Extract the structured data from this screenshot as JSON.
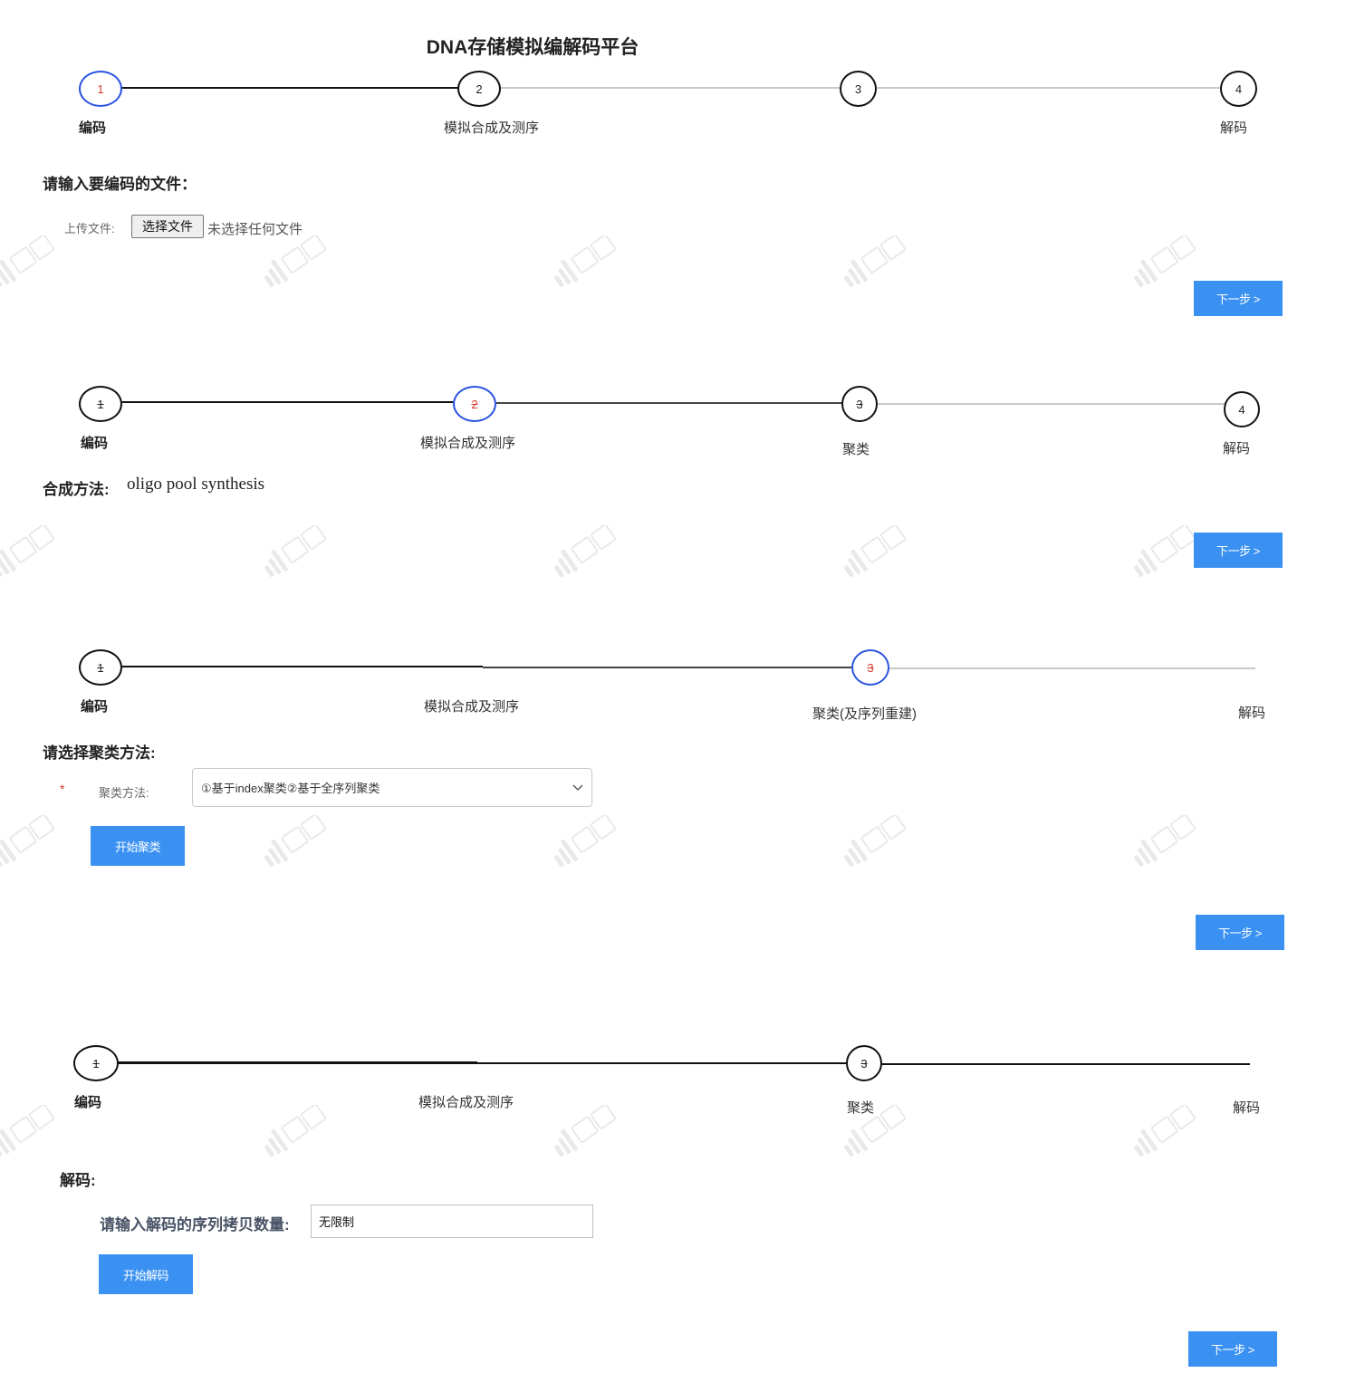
{
  "page_title": "DNA存储模拟编解码平台",
  "steps_1": [
    "编码",
    "模拟合成及测序",
    "解码"
  ],
  "steps_2": [
    "编码",
    "模拟合成及测序",
    "聚类",
    "解码"
  ],
  "steps_3": [
    "编码",
    "模拟合成及测序",
    "聚类(及序列重建)",
    "解码"
  ],
  "steps_4": [
    "编码",
    "模拟合成及测序",
    "聚类",
    "解码"
  ],
  "step_numbers": [
    "1",
    "2",
    "3",
    "4"
  ],
  "encode": {
    "heading": "请输入要编码的文件：",
    "upload_label": "上传文件:",
    "file_button": "选择文件",
    "file_status": "未选择任何文件"
  },
  "synthesis": {
    "heading": "合成方法:",
    "value": "oligo pool synthesis"
  },
  "cluster": {
    "heading": "请选择聚类方法:",
    "required_mark": "*",
    "method_label": "聚类方法:",
    "method_value": "①基于index聚类②基于全序列聚类",
    "start_button": "开始聚类"
  },
  "decode": {
    "heading": "解码:",
    "copies_label": "请输入解码的序列拷贝数量:",
    "copies_value": "无限制",
    "start_button": "开始解码"
  },
  "next_button": "下一步 >",
  "colors": {
    "primary_button": "#3a91f2",
    "active_step_border": "#2d55e0",
    "active_step_number": "#d23b2b",
    "required_mark": "#d23b2b"
  }
}
